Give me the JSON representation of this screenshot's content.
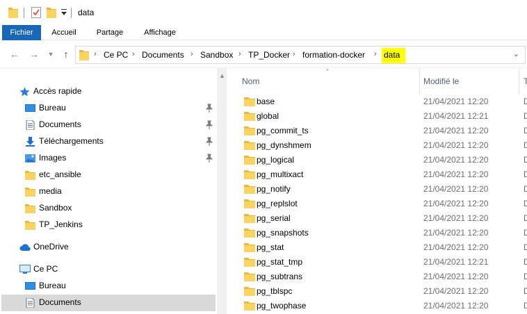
{
  "window": {
    "title": "data"
  },
  "ribbon": {
    "tabs": [
      {
        "label": "Fichier"
      },
      {
        "label": "Accueil"
      },
      {
        "label": "Partage"
      },
      {
        "label": "Affichage"
      }
    ]
  },
  "address": {
    "breadcrumbs": [
      "Ce PC",
      "Documents",
      "Sandbox",
      "TP_Docker",
      "formation-docker",
      "data"
    ],
    "highlight_color": "#ffff00"
  },
  "nav": {
    "quick_access": {
      "label": "Accès rapide"
    },
    "items": [
      {
        "label": "Bureau",
        "icon": "desktop-icon",
        "pinned": true
      },
      {
        "label": "Documents",
        "icon": "document-icon",
        "pinned": true
      },
      {
        "label": "Téléchargements",
        "icon": "download-icon",
        "pinned": true
      },
      {
        "label": "Images",
        "icon": "images-icon",
        "pinned": true
      },
      {
        "label": "etc_ansible",
        "icon": "folder-icon",
        "pinned": false
      },
      {
        "label": "media",
        "icon": "folder-icon",
        "pinned": false
      },
      {
        "label": "Sandbox",
        "icon": "folder-icon",
        "pinned": false
      },
      {
        "label": "TP_Jenkins",
        "icon": "folder-icon",
        "pinned": false
      }
    ],
    "onedrive": {
      "label": "OneDrive"
    },
    "thispc": {
      "label": "Ce PC"
    },
    "pc_items": [
      {
        "label": "Bureau",
        "icon": "desktop-icon"
      },
      {
        "label": "Documents",
        "icon": "document-icon",
        "selected": true
      }
    ]
  },
  "columns": {
    "name": "Nom",
    "modified": "Modifié le",
    "type": "T"
  },
  "files": [
    {
      "name": "base",
      "modified": "21/04/2021 12:20",
      "type": "D"
    },
    {
      "name": "global",
      "modified": "21/04/2021 12:21",
      "type": "D"
    },
    {
      "name": "pg_commit_ts",
      "modified": "21/04/2021 12:20",
      "type": "D"
    },
    {
      "name": "pg_dynshmem",
      "modified": "21/04/2021 12:20",
      "type": "D"
    },
    {
      "name": "pg_logical",
      "modified": "21/04/2021 12:20",
      "type": "D"
    },
    {
      "name": "pg_multixact",
      "modified": "21/04/2021 12:20",
      "type": "D"
    },
    {
      "name": "pg_notify",
      "modified": "21/04/2021 12:20",
      "type": "D"
    },
    {
      "name": "pg_replslot",
      "modified": "21/04/2021 12:20",
      "type": "D"
    },
    {
      "name": "pg_serial",
      "modified": "21/04/2021 12:20",
      "type": "D"
    },
    {
      "name": "pg_snapshots",
      "modified": "21/04/2021 12:20",
      "type": "D"
    },
    {
      "name": "pg_stat",
      "modified": "21/04/2021 12:20",
      "type": "D"
    },
    {
      "name": "pg_stat_tmp",
      "modified": "21/04/2021 12:21",
      "type": "D"
    },
    {
      "name": "pg_subtrans",
      "modified": "21/04/2021 12:20",
      "type": "D"
    },
    {
      "name": "pg_tblspc",
      "modified": "21/04/2021 12:20",
      "type": "D"
    },
    {
      "name": "pg_twophase",
      "modified": "21/04/2021 12:20",
      "type": "D"
    }
  ],
  "colors": {
    "accent": "#1a66b8",
    "folder": "#fbd460",
    "selection": "#d9d9d9"
  }
}
